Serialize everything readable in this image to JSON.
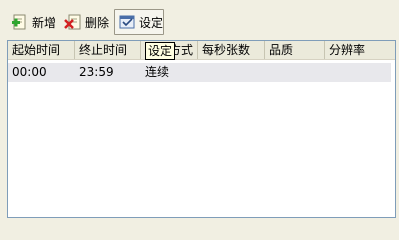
{
  "toolbar": {
    "add": {
      "label": "新增",
      "icon": "add-document-icon"
    },
    "delete": {
      "label": "删除",
      "icon": "delete-document-icon"
    },
    "settings": {
      "label": "设定",
      "icon": "settings-window-icon"
    }
  },
  "list": {
    "columns": [
      "起始时间",
      "终止时间",
      "录像方式",
      "每秒张数",
      "品质",
      "分辨率"
    ],
    "rows": [
      {
        "start": "00:00",
        "end": "23:59",
        "mode": "连续",
        "fps": "",
        "quality": "",
        "resolution": ""
      }
    ]
  },
  "tooltip": {
    "text": "设定"
  },
  "colors": {
    "window_bg": "#f1efe2",
    "header_bg": "#ebeadb",
    "row_selected_bg": "#e8e8ec",
    "list_border": "#7f9db9",
    "tooltip_bg": "#ffffe1"
  }
}
